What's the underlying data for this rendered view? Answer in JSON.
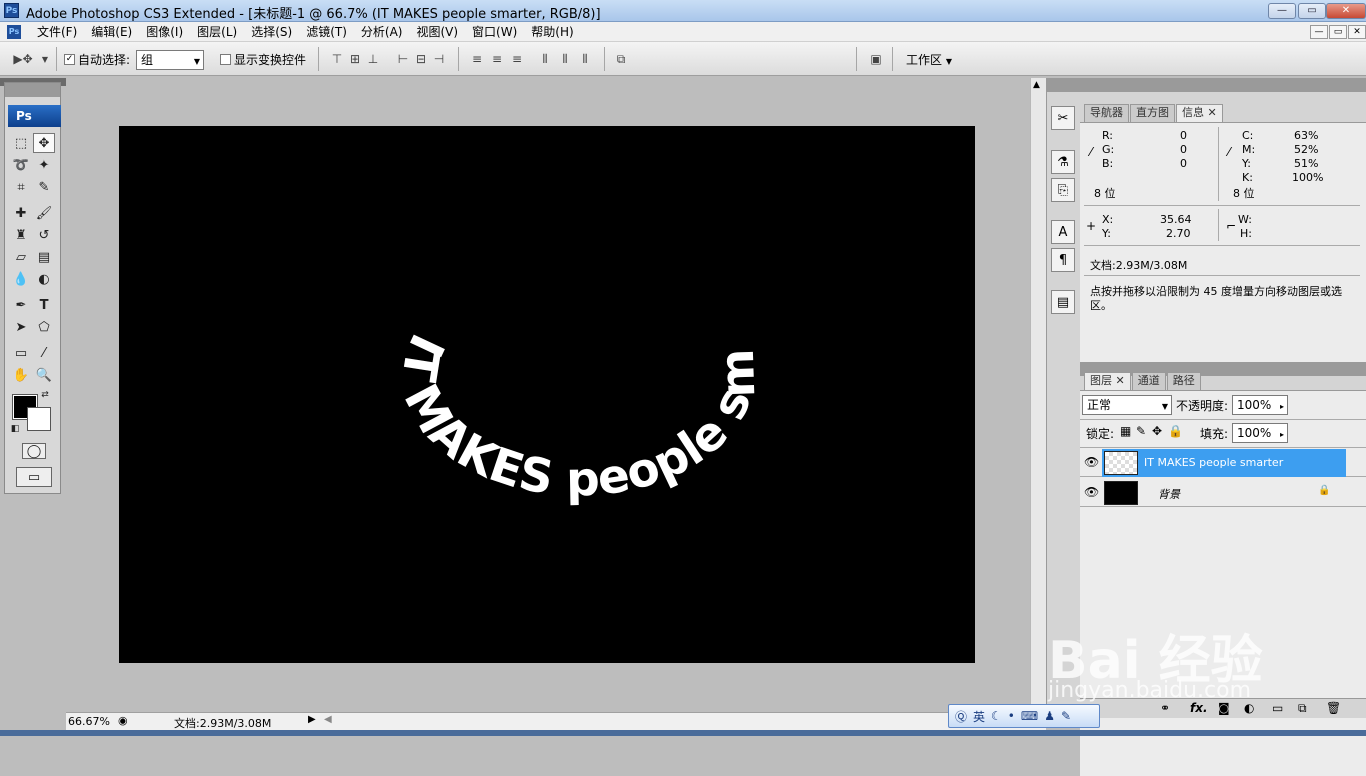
{
  "title_bar": {
    "title": "Adobe Photoshop CS3 Extended - [未标题-1 @ 66.7% (IT  MAKES people smarter, RGB/8)]",
    "min": "—",
    "max": "▭",
    "close": "✕"
  },
  "menu": [
    "文件(F)",
    "编辑(E)",
    "图像(I)",
    "图层(L)",
    "选择(S)",
    "滤镜(T)",
    "分析(A)",
    "视图(V)",
    "窗口(W)",
    "帮助(H)"
  ],
  "options_bar": {
    "auto_select_label": "自动选择:",
    "auto_select_checked": true,
    "group_value": "组",
    "show_transform_label": "显示变换控件",
    "workspace_label": "工作区"
  },
  "canvas": {
    "text": "IT  MAKES people smarter",
    "background": "#000000",
    "text_color": "#ffffff"
  },
  "info_panel": {
    "tabs": [
      "导航器",
      "直方图",
      "信息"
    ],
    "active_tab": "信息",
    "rgb": [
      {
        "label": "R:",
        "value": "0"
      },
      {
        "label": "G:",
        "value": "0"
      },
      {
        "label": "B:",
        "value": "0"
      }
    ],
    "cmyk": [
      {
        "label": "C:",
        "value": "63%"
      },
      {
        "label": "M:",
        "value": "52%"
      },
      {
        "label": "Y:",
        "value": "51%"
      },
      {
        "label": "K:",
        "value": "100%"
      }
    ],
    "bits_left": "8 位",
    "bits_right": "8 位",
    "x_label": "X:",
    "x_value": "35.64",
    "y_label": "Y:",
    "y_value": "2.70",
    "w_label": "W:",
    "h_label": "H:",
    "doc": "文档:2.93M/3.08M",
    "hint": "点按并拖移以沿限制为 45 度增量方向移动图层或选区。"
  },
  "layers_panel": {
    "tabs": [
      "图层",
      "通道",
      "路径"
    ],
    "active_tab": "图层",
    "blend_mode": "正常",
    "opacity_label": "不透明度:",
    "opacity": "100%",
    "lock_label": "锁定:",
    "fill_label": "填充:",
    "fill": "100%",
    "layers": [
      {
        "name": "IT  MAKES people smarter",
        "selected": true
      },
      {
        "name": "背景",
        "selected": false
      }
    ]
  },
  "status_bar": {
    "zoom": "66.67%",
    "doc": "文档:2.93M/3.08M"
  },
  "ime": {
    "lang": "英"
  },
  "watermark": {
    "brand": "Bai 经验",
    "url": "jingyan.baidu.com"
  }
}
